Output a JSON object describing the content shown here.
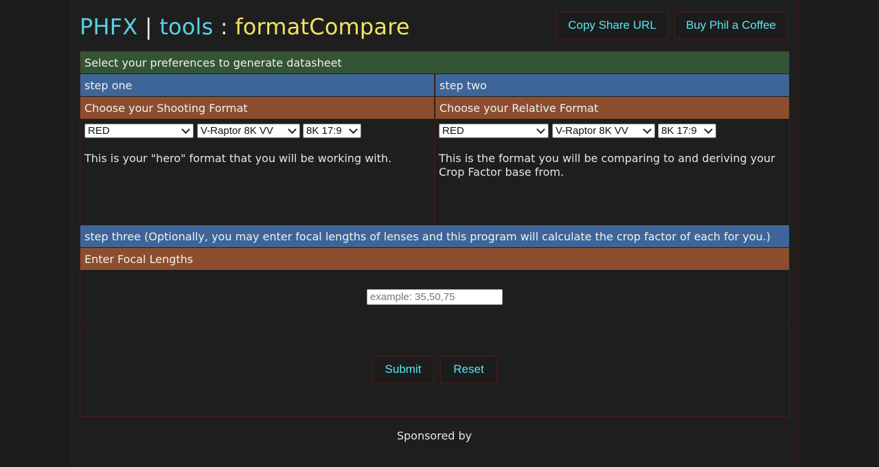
{
  "header": {
    "brand": "PHFX",
    "separator": "|",
    "tools": "tools",
    "colon": ":",
    "app_name": "formatCompare",
    "share_button": "Copy Share URL",
    "coffee_button": "Buy Phil a Coffee"
  },
  "intro_bar": "Select your preferences to generate datasheet",
  "step_one": {
    "heading": "step one",
    "subheading": "Choose your Shooting Format",
    "manufacturer": "RED",
    "camera": "V-Raptor 8K VV",
    "resolution": "8K 17:9",
    "description": "This is your \"hero\" format that you will be working with."
  },
  "step_two": {
    "heading": "step two",
    "subheading": "Choose your Relative Format",
    "manufacturer": "RED",
    "camera": "V-Raptor 8K VV",
    "resolution": "8K 17:9",
    "description": "This is the format you will be comparing to and deriving your Crop Factor base from."
  },
  "step_three": {
    "heading": "step three (Optionally, you may enter focal lengths of lenses and this program will calculate the crop factor of each for you.)",
    "subheading": "Enter Focal Lengths",
    "input_placeholder": "example: 35,50,75"
  },
  "actions": {
    "submit": "Submit",
    "reset": "Reset"
  },
  "footer": {
    "sponsored": "Sponsored by"
  },
  "colors": {
    "background": "#1c1c1c",
    "accent_cyan": "#59d0e6",
    "accent_yellow": "#f1e463",
    "bar_green": "#345436",
    "bar_blue": "#3e6597",
    "bar_orange": "#8c4e2e",
    "border_red": "#4a1d18"
  }
}
